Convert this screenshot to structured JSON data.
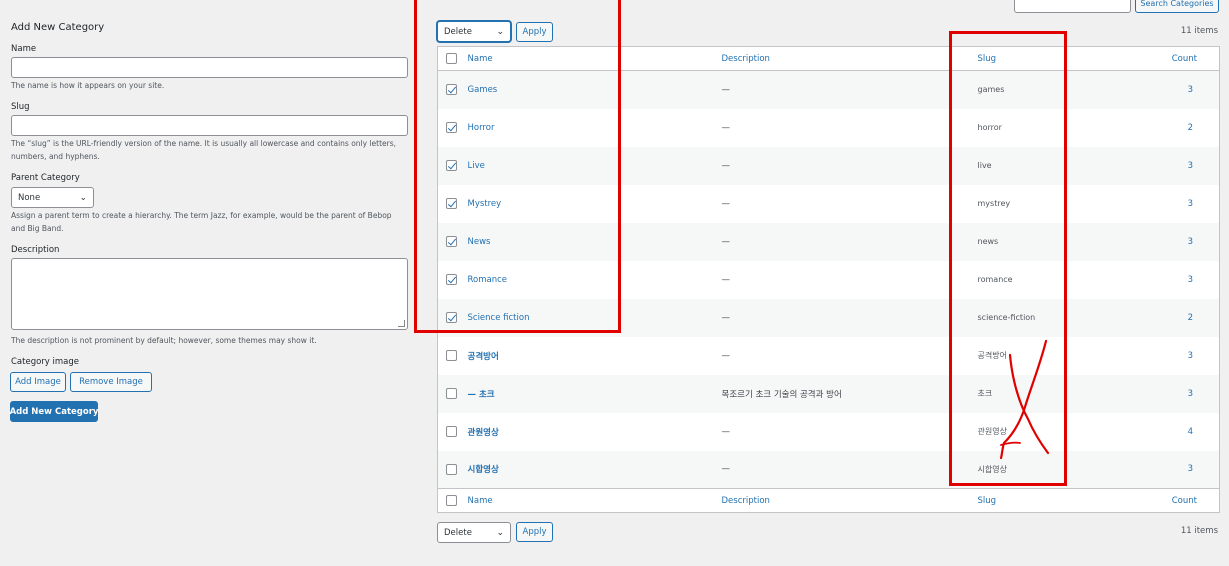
{
  "form": {
    "heading": "Add New Category",
    "name_label": "Name",
    "name_help": "The name is how it appears on your site.",
    "slug_label": "Slug",
    "slug_help": "The “slug” is the URL-friendly version of the name. It is usually all lowercase and contains only letters, numbers, and hyphens.",
    "parent_label": "Parent Category",
    "parent_value": "None",
    "parent_help": "Assign a parent term to create a hierarchy. The term Jazz, for example, would be the parent of Bebop and Big Band.",
    "description_label": "Description",
    "description_help": "The description is not prominent by default; however, some themes may show it.",
    "image_label": "Category image",
    "add_image": "Add Image",
    "remove_image": "Remove Image",
    "submit": "Add New Category"
  },
  "search": {
    "button": "Search Categories"
  },
  "bulk": {
    "action": "Delete",
    "apply": "Apply",
    "items": "11 items"
  },
  "columns": {
    "name": "Name",
    "description": "Description",
    "slug": "Slug",
    "count": "Count"
  },
  "rows": [
    {
      "checked": true,
      "name": "Games",
      "description": "—",
      "slug": "games",
      "count": "3"
    },
    {
      "checked": true,
      "name": "Horror",
      "description": "—",
      "slug": "horror",
      "count": "2"
    },
    {
      "checked": true,
      "name": "Live",
      "description": "—",
      "slug": "live",
      "count": "3"
    },
    {
      "checked": true,
      "name": "Mystrey",
      "description": "—",
      "slug": "mystrey",
      "count": "3"
    },
    {
      "checked": true,
      "name": "News",
      "description": "—",
      "slug": "news",
      "count": "3"
    },
    {
      "checked": true,
      "name": "Romance",
      "description": "—",
      "slug": "romance",
      "count": "3"
    },
    {
      "checked": true,
      "name": "Science fiction",
      "description": "—",
      "slug": "science-fiction",
      "count": "2"
    },
    {
      "checked": false,
      "name": "공격방어",
      "description": "—",
      "slug": "공격방어",
      "count": "3",
      "bold": true
    },
    {
      "checked": false,
      "name": "— 초크",
      "description": "목조르기 초크 기술의 공격과 방어",
      "slug": "초크",
      "count": "3",
      "bold": true
    },
    {
      "checked": false,
      "name": "관원영상",
      "description": "—",
      "slug": "관원영상",
      "count": "4",
      "bold": true
    },
    {
      "checked": false,
      "name": "시합영상",
      "description": "—",
      "slug": "시합영상",
      "count": "3",
      "bold": true
    }
  ],
  "colors": {
    "annotation": "#e00000",
    "link": "#2271b1",
    "primary": "#2271b1"
  }
}
